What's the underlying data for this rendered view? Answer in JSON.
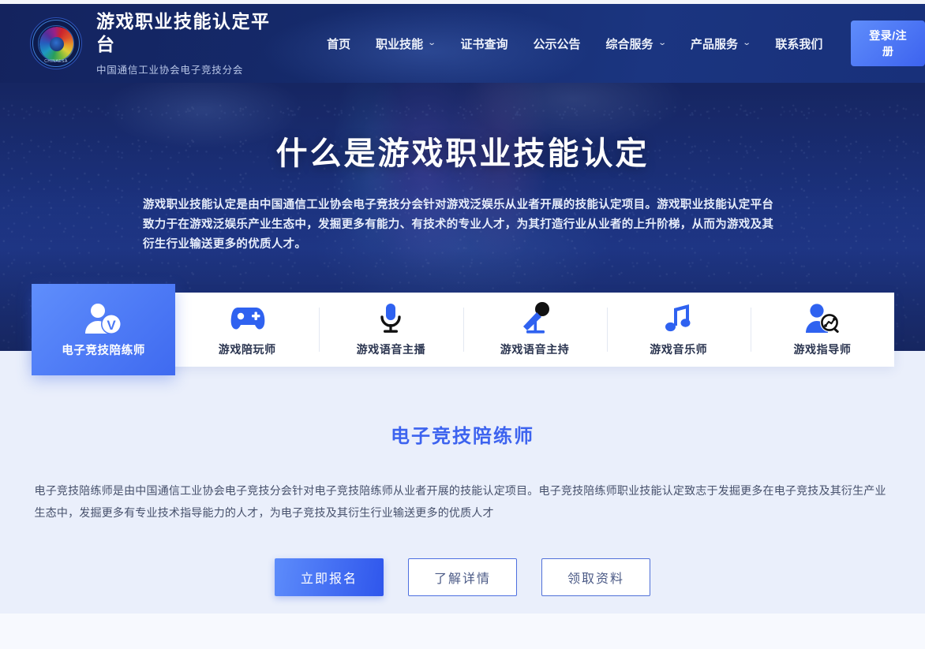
{
  "header": {
    "logo_icon": "chinaesa-emblem-icon",
    "brand_title": "游戏职业技能认定平台",
    "brand_subtitle": "中国通信工业协会电子竞技分会",
    "nav": [
      {
        "label": "首页",
        "has_dropdown": false
      },
      {
        "label": "职业技能",
        "has_dropdown": true
      },
      {
        "label": "证书查询",
        "has_dropdown": false
      },
      {
        "label": "公示公告",
        "has_dropdown": false
      },
      {
        "label": "综合服务",
        "has_dropdown": true
      },
      {
        "label": "产品服务",
        "has_dropdown": true
      },
      {
        "label": "联系我们",
        "has_dropdown": false
      }
    ],
    "caret_icon": "chevron-down-icon",
    "login_label": "登录/注册",
    "bg_color": "#16255f",
    "accent_color": "#3d63ef"
  },
  "hero": {
    "title": "什么是游戏职业技能认定",
    "description": "游戏职业技能认定是由中国通信工业协会电子竞技分会针对游戏泛娱乐从业者开展的技能认定项目。游戏职业技能认定平台致力于在游戏泛娱乐产业生态中，发掘更多有能力、有技术的专业人才，为其打造行业从业者的上升阶梯，从而为游戏及其衍生行业输送更多的优质人才。"
  },
  "tabs": [
    {
      "label": "电子竞技陪练师",
      "icon": "user-verified-icon",
      "active": true
    },
    {
      "label": "游戏陪玩师",
      "icon": "gamepad-icon",
      "active": false
    },
    {
      "label": "游戏语音主播",
      "icon": "microphone-icon",
      "active": false
    },
    {
      "label": "游戏语音主持",
      "icon": "mic-stand-icon",
      "active": false
    },
    {
      "label": "游戏音乐师",
      "icon": "music-note-icon",
      "active": false
    },
    {
      "label": "游戏指导师",
      "icon": "user-coach-icon",
      "active": false
    }
  ],
  "main": {
    "title": "电子竞技陪练师",
    "description": "电子竞技陪练师是由中国通信工业协会电子竞技分会针对电子竞技陪练师从业者开展的技能认定项目。电子竞技陪练师职业技能认定致志于发掘更多在电子竞技及其衍生产业生态中，发掘更多有专业技术指导能力的人才，为电子竞技及其衍生行业输送更多的优质人才",
    "buttons": [
      {
        "label": "立即报名",
        "style": "primary"
      },
      {
        "label": "了解详情",
        "style": "ghost"
      },
      {
        "label": "领取资料",
        "style": "ghost"
      }
    ]
  }
}
